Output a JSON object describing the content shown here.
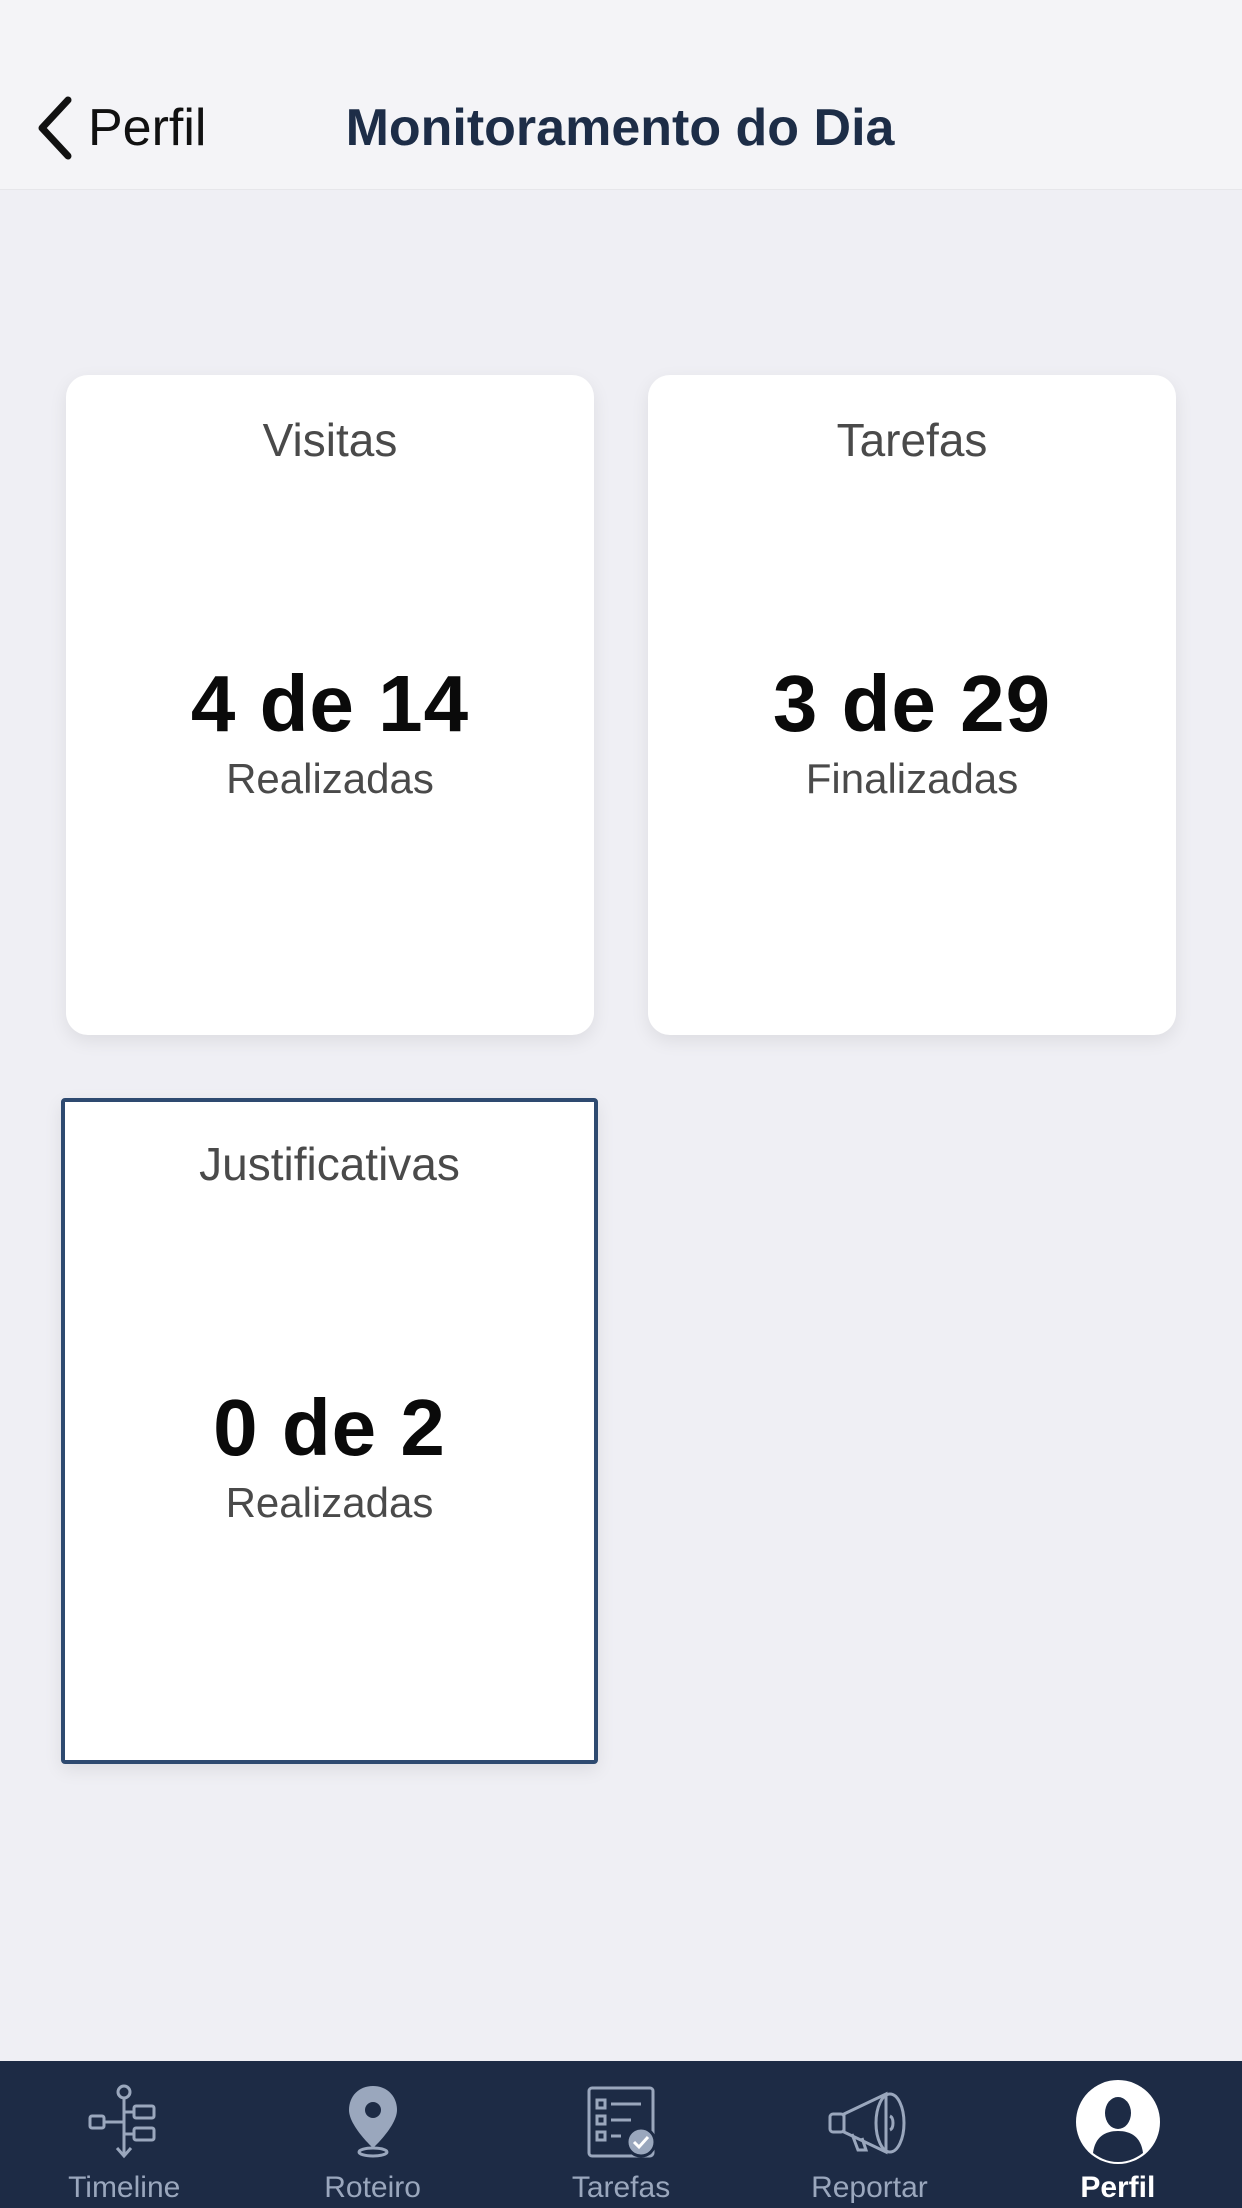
{
  "header": {
    "back_label": "Perfil",
    "title": "Monitoramento do Dia"
  },
  "cards": [
    {
      "title": "Visitas",
      "value": "4 de 14",
      "subtitle": "Realizadas"
    },
    {
      "title": "Tarefas",
      "value": "3 de 29",
      "subtitle": "Finalizadas"
    },
    {
      "title": "Justificativas",
      "value": "0 de 2",
      "subtitle": "Realizadas"
    }
  ],
  "tabbar": {
    "items": [
      {
        "label": "Timeline",
        "icon": "timeline-icon",
        "active": false
      },
      {
        "label": "Roteiro",
        "icon": "map-pin-icon",
        "active": false
      },
      {
        "label": "Tarefas",
        "icon": "task-list-icon",
        "active": false
      },
      {
        "label": "Reportar",
        "icon": "megaphone-icon",
        "active": false
      },
      {
        "label": "Perfil",
        "icon": "profile-icon",
        "active": true
      }
    ]
  },
  "colors": {
    "tabbar_bg": "#1d2b45",
    "title": "#1d2d47",
    "inactive_tab": "#9aa7bd",
    "selected_border": "#2e4a70"
  }
}
